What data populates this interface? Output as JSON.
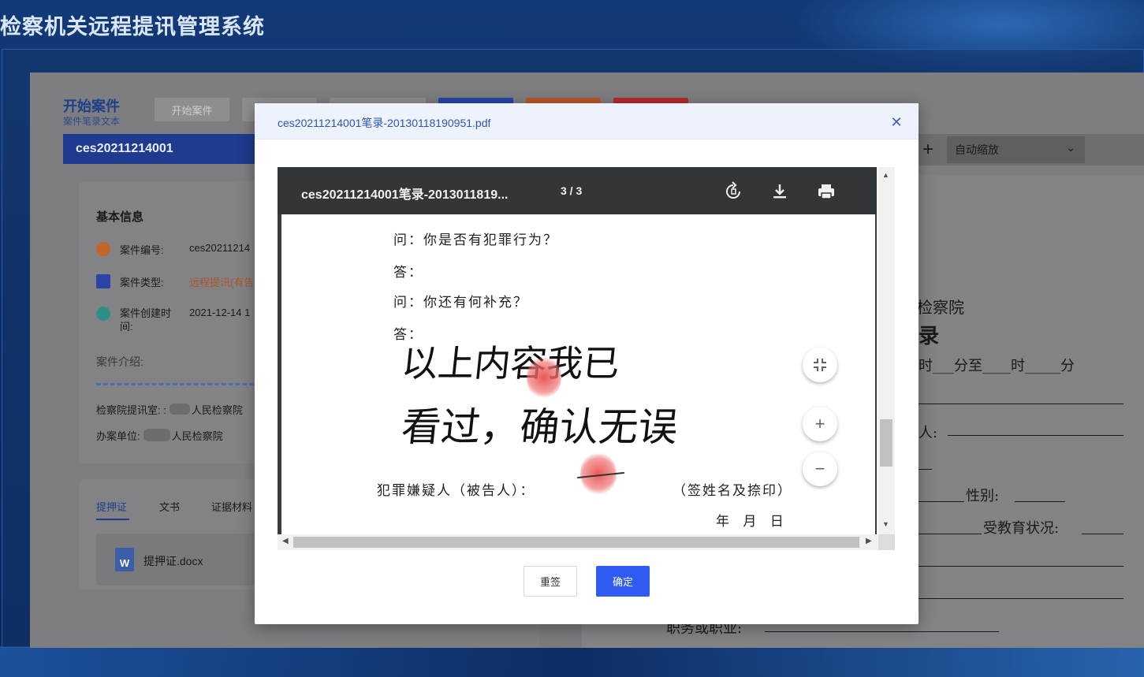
{
  "app": {
    "title": "检察机关远程提讯管理系统"
  },
  "page": {
    "header_title": "开始案件",
    "header_subtitle": "案件笔录文本",
    "toolbar": {
      "start_case_label": "开始案件"
    },
    "case_bar": "ces20211214001",
    "info": {
      "section_title": "基本信息",
      "case_no_label": "案件编号:",
      "case_no_value": "ces20211214",
      "case_type_label": "案件类型:",
      "case_type_value": "远程提讯(有告",
      "created_label": "案件创建时间:",
      "created_value": "2021-12-14 1",
      "intro_label": "案件介绍:",
      "room_label": "检察院提讯室: :",
      "room_value": "人民检察院",
      "unit_label": "办案单位:",
      "unit_value": "人民检察院"
    },
    "tabs": [
      "提押证",
      "文书",
      "证据材料"
    ],
    "file": {
      "name": "提押证.docx",
      "icon_letter": "W"
    }
  },
  "right_viewer": {
    "zoom_label": "自动缩放",
    "lines": {
      "court": "检察院",
      "record": "录",
      "time": "时___分至____时_____分",
      "person": "人:",
      "gender": "性别:",
      "education": "受教育状况:",
      "job": "职务或职业:"
    }
  },
  "modal": {
    "title": "ces20211214001笔录-20130118190951.pdf",
    "pdf": {
      "title": "ces20211214001笔录-2013011819...",
      "pages": "3 / 3",
      "content": {
        "q1": "问：你是否有犯罪行为？",
        "a1": "答：",
        "q2": "问：你还有何补充？",
        "a2": "答：",
        "handwriting_line1": "以上内容我已",
        "handwriting_line2": "看过，确认无误",
        "suspect_label": "犯罪嫌疑人（被告人）：",
        "sign_note": "（签姓名及捺印）",
        "date_line": "年  月  日"
      }
    },
    "buttons": {
      "reset": "重签",
      "confirm": "确定"
    }
  }
}
